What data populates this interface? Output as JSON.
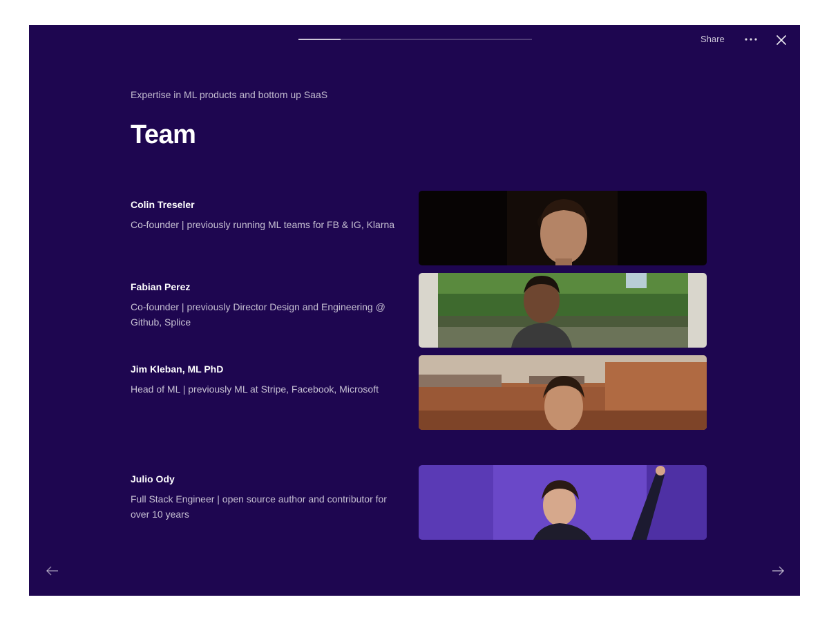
{
  "progress": 0.18,
  "header": {
    "share_label": "Share",
    "more_icon": "more-dots-icon",
    "close_icon": "close-icon"
  },
  "slide": {
    "subtitle": "Expertise in ML products and bottom up SaaS",
    "title": "Team"
  },
  "team": [
    {
      "name": "Colin Treseler",
      "role": "Co-founder | previously running ML teams for FB & IG, Klarna"
    },
    {
      "name": "Fabian Perez",
      "role": "Co-founder | previously Director Design and Engineering @ Github, Splice"
    },
    {
      "name": "Jim Kleban, ML PhD",
      "role": "Head of ML | previously ML at Stripe, Facebook, Microsoft"
    },
    {
      "name": "Julio Ody",
      "role": "Full Stack Engineer | open source author and contributor for over 10 years"
    }
  ],
  "navigation": {
    "prev_icon": "arrow-left-icon",
    "next_icon": "arrow-right-icon"
  },
  "colors": {
    "background": "#1e0650",
    "accent": "#5a3ab5"
  }
}
